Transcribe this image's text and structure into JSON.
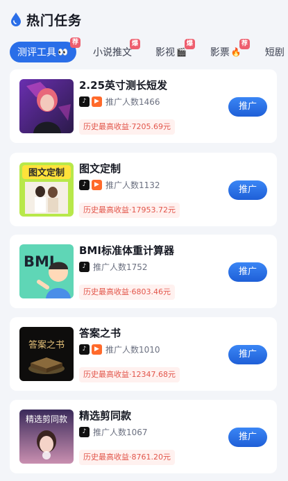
{
  "header": {
    "title": "热门任务",
    "icon": "water-drop-icon"
  },
  "tabs": [
    {
      "label": "测评工具",
      "emoji": "👀",
      "badge": "荐",
      "active": true
    },
    {
      "label": "小说推文",
      "emoji": "",
      "badge": "爆",
      "active": false
    },
    {
      "label": "影视",
      "emoji": "🎬",
      "badge": "爆",
      "active": false
    },
    {
      "label": "影票",
      "emoji": "🔥",
      "badge": "荐",
      "active": false
    },
    {
      "label": "短剧",
      "emoji": "",
      "badge": "",
      "active": false
    }
  ],
  "cards": [
    {
      "title": "2.25英寸测长短发",
      "platforms": [
        "douyin-icon",
        "kuaishou-icon"
      ],
      "count_label": "推广人数1466",
      "income_label": "历史最高收益·7205.69元",
      "button": "推广",
      "thumb": "portrait-woman"
    },
    {
      "title": "图文定制",
      "platforms": [
        "douyin-icon",
        "kuaishou-icon"
      ],
      "count_label": "推广人数1132",
      "income_label": "历史最高收益·17953.72元",
      "button": "推广",
      "thumb": "photo-custom",
      "thumb_text": "图文定制"
    },
    {
      "title": "BMI标准体重计算器",
      "platforms": [
        "douyin-icon"
      ],
      "count_label": "推广人数1752",
      "income_label": "历史最高收益·6803.46元",
      "button": "推广",
      "thumb": "bmi",
      "thumb_text": "BMI"
    },
    {
      "title": "答案之书",
      "platforms": [
        "douyin-icon",
        "kuaishou-icon"
      ],
      "count_label": "推广人数1010",
      "income_label": "历史最高收益·12347.68元",
      "button": "推广",
      "thumb": "answer-book",
      "thumb_text": "答案之书"
    },
    {
      "title": "精选剪同款",
      "platforms": [
        "douyin-icon"
      ],
      "count_label": "推广人数1067",
      "income_label": "历史最高收益·8761.20元",
      "button": "推广",
      "thumb": "clip-same",
      "thumb_text": "精选剪同款"
    }
  ],
  "colors": {
    "accent": "#2a6ee8",
    "badge": "#ee5e6e",
    "income_text": "#e2554a",
    "income_bg": "#fff1ef",
    "background": "#f3f5f9"
  }
}
